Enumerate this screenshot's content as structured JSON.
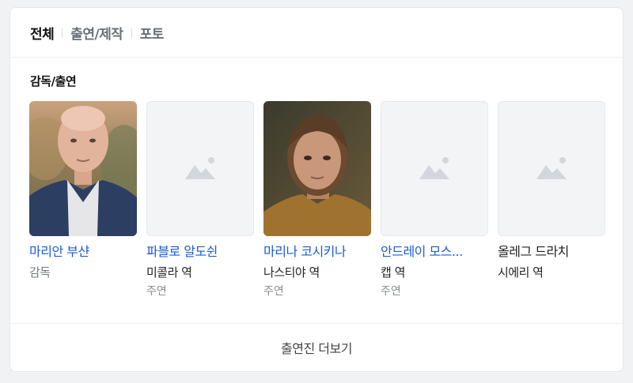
{
  "tabs": [
    {
      "label": "전체",
      "active": true
    },
    {
      "label": "출연/제작",
      "active": false
    },
    {
      "label": "포토",
      "active": false
    }
  ],
  "section_title": "감독/출연",
  "people": [
    {
      "name": "마리안 부샨",
      "role": "감독",
      "type": "",
      "has_photo": true
    },
    {
      "name": "파블로 알도쉰",
      "role": "미콜라 역",
      "type": "주연",
      "has_photo": false
    },
    {
      "name": "마리나 코시키나",
      "role": "나스티야 역",
      "type": "주연",
      "has_photo": true
    },
    {
      "name": "안드레이 모스...",
      "role": "캡 역",
      "type": "주연",
      "has_photo": false
    },
    {
      "name": "올레그 드라치",
      "role": "시에리 역",
      "type": "",
      "has_photo": false
    }
  ],
  "more_button": "출연진 더보기",
  "icons": {
    "placeholder": "image-placeholder-icon"
  },
  "colors": {
    "link": "#1a5bd6",
    "placeholder_bg": "#f3f4f6"
  }
}
